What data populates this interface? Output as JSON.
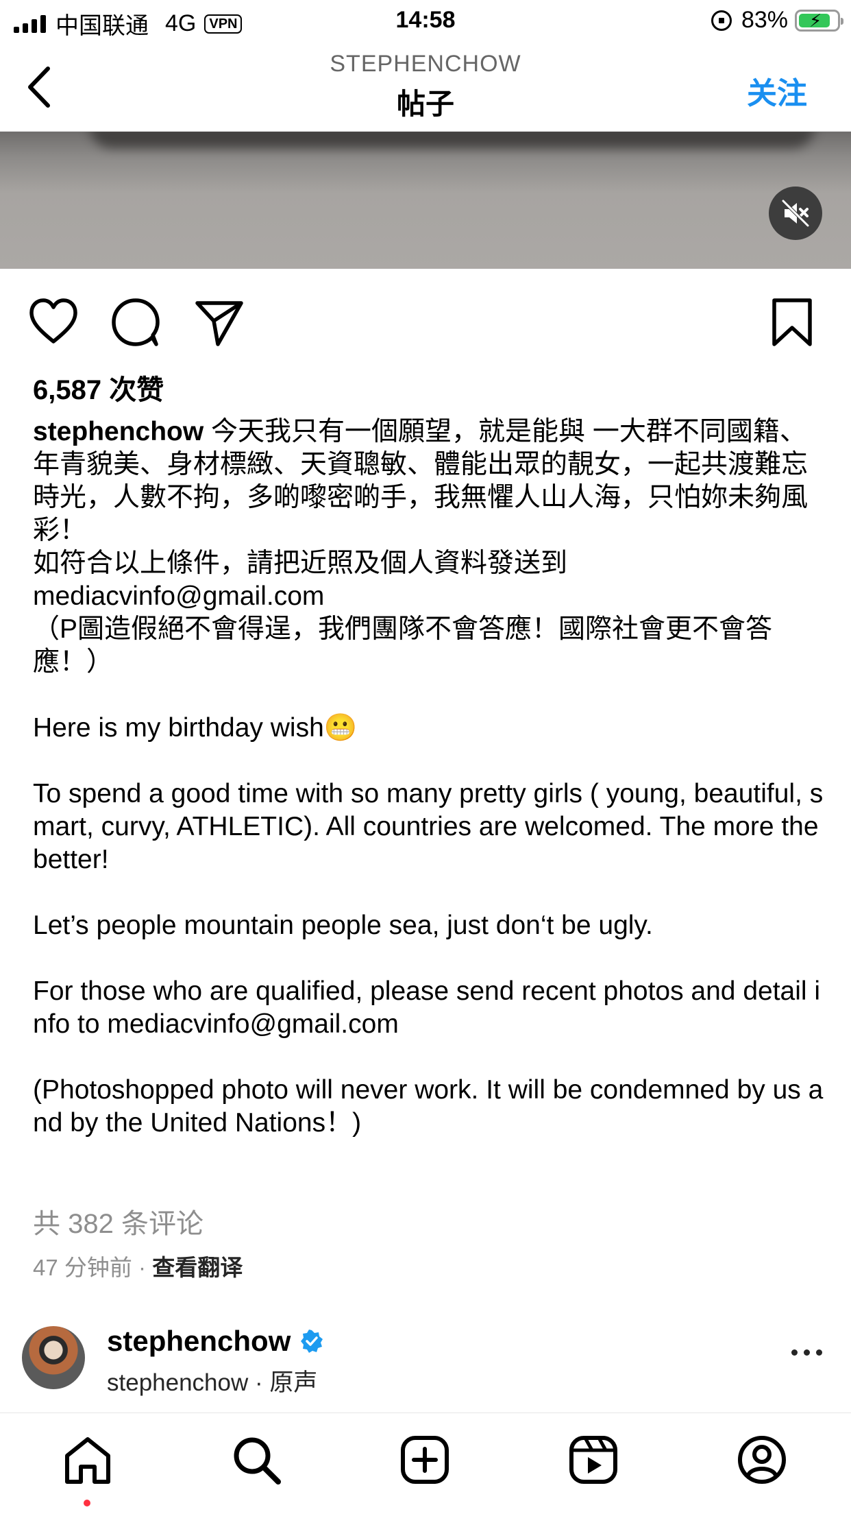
{
  "status_bar": {
    "carrier": "中国联通",
    "network": "4G",
    "vpn": "VPN",
    "time": "14:58",
    "battery": "83%",
    "battery_level": 0.83
  },
  "header": {
    "username": "STEPHENCHOW",
    "title": "帖子",
    "follow_label": "关注"
  },
  "post": {
    "likes": "6,587 次赞",
    "caption_user": "stephenchow",
    "caption_text": " 今天我只有一個願望，就是能與 一大群不同國籍、年青貌美、身材標緻、天資聰敏、體能出眾的靚女，一起共渡難忘時光，人數不拘，多啲嚟密啲手，我無懼人山人海，只怕妳未夠風彩！\n如符合以上條件，請把近照及個人資料發送到\nmediacvinfo@gmail.com\n（P圖造假絕不會得逞，我們團隊不會答應！國際社會更不會答應！）\n\nHere is my birthday wish😬\n\nTo spend a good time with so many pretty girls ( young, beautiful, smart, curvy, ATHLETIC). All countries are welcomed. The more the better!\n\nLet’s people mountain people sea, just don‘t be ugly.\n\nFor those who are qualified, please send recent photos and detail info to mediacvinfo@gmail.com\n\n(Photoshopped photo will never work. It will be condemned by us and by the United Nations！)",
    "comments_link": "共 382 条评论",
    "time_ago": "47 分钟前",
    "separator": " · ",
    "translate_label": "查看翻译"
  },
  "next_post": {
    "username": "stephenchow",
    "subtitle": "stephenchow · 原声"
  },
  "icons": {
    "back": "chevron-left-icon",
    "mute": "speaker-muted-icon",
    "like": "heart-icon",
    "comment": "comment-bubble-icon",
    "share": "paper-plane-icon",
    "save": "bookmark-icon",
    "verified": "verified-badge-icon",
    "more": "more-horizontal-icon",
    "tabs": [
      "home-icon",
      "search-icon",
      "create-icon",
      "reels-icon",
      "profile-icon"
    ]
  },
  "colors": {
    "accent": "#1a8ff0",
    "verified": "#1d9bf0",
    "notification_dot": "#ff3040",
    "battery": "#33c759",
    "secondary_text": "#8e8e8e"
  }
}
